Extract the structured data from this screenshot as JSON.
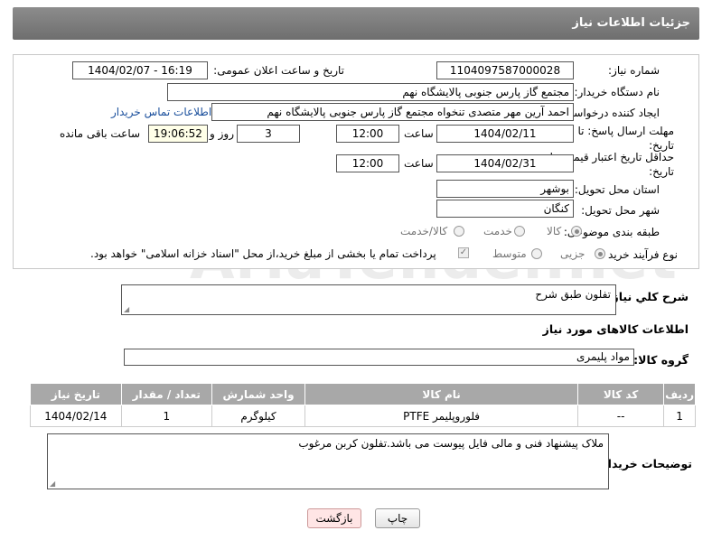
{
  "header": {
    "title": "جزئیات اطلاعات نیاز"
  },
  "form": {
    "need_number_label": "شماره نیاز:",
    "need_number": "1104097587000028",
    "announce_label": "تاریخ و ساعت اعلان عمومی:",
    "announce_value": "1404/02/07 - 16:19",
    "buyer_org_label": "نام دستگاه خریدار:",
    "buyer_org": "مجتمع گاز پارس جنوبی  پالایشگاه نهم",
    "requester_label": "ایجاد کننده درخواست:",
    "requester": "احمد آرین مهر متصدی تنخواه مجتمع گاز پارس جنوبی  پالایشگاه نهم",
    "contact_link": "اطلاعات تماس خریدار",
    "reply_deadline_label": "مهلت ارسال پاسخ: تا تاریخ:",
    "reply_date": "1404/02/11",
    "time_label": "ساعت",
    "reply_time": "12:00",
    "days_value": "3",
    "days_label": "روز و",
    "remaining_time": "19:06:52",
    "remaining_label": "ساعت باقی مانده",
    "price_validity_label": "حداقل تاریخ اعتبار قیمت: تا تاریخ:",
    "validity_date": "1404/02/31",
    "validity_time_label": "ساعت",
    "validity_time": "12:00",
    "province_label": "استان محل تحویل:",
    "province": "بوشهر",
    "city_label": "شهر محل تحویل:",
    "city": "کنگان",
    "category_label": "طبقه بندی موضوعی:",
    "category_options": [
      "کالا",
      "خدمت",
      "کالا/خدمت"
    ],
    "process_label": "نوع فرآیند خرید :",
    "process_options": [
      "جزیی",
      "متوسط"
    ],
    "payment_note": "پرداخت تمام یا بخشی از مبلغ خرید،از محل \"اسناد خزانه اسلامی\" خواهد بود."
  },
  "description": {
    "label": "شرح كلي نياز:",
    "value": "تفلون طبق شرح"
  },
  "goods": {
    "section_title": "اطلاعات کالاهای مورد نیاز",
    "group_label": "گروه کالا:",
    "group_value": "مواد پلیمری",
    "columns": [
      "ردیف",
      "کد کالا",
      "نام کالا",
      "واحد شمارش",
      "تعداد / مقدار",
      "تاریخ نیاز"
    ],
    "rows": [
      [
        "1",
        "--",
        "فلوروپلیمر PTFE",
        "کیلوگرم",
        "1",
        "1404/02/14"
      ]
    ]
  },
  "buyer_notes": {
    "label": "توضیحات خریدار:",
    "value": "ملاک پیشنهاد فنی و مالی فایل پیوست می باشد.تفلون کربن مرغوب"
  },
  "buttons": {
    "print": "چاپ",
    "back": "بازگشت"
  },
  "watermark": "AriaTender.net"
}
